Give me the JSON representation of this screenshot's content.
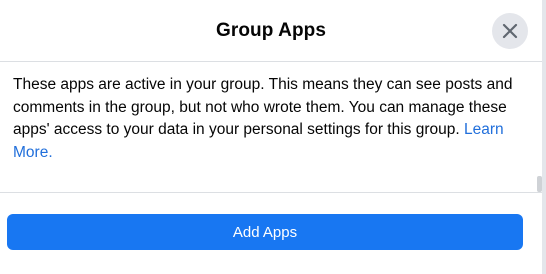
{
  "dialog": {
    "title": "Group Apps",
    "close_icon": "close-icon",
    "description": "These apps are active in your group. This means they can see posts and comments in the group, but not who wrote them. You can manage these apps' access to your data in your personal settings for this group.",
    "learn_more_label": "Learn More.",
    "add_button_label": "Add Apps"
  },
  "colors": {
    "primary": "#1877f2",
    "link": "#216fdb",
    "close_bg": "#e4e6eb",
    "text": "#050505"
  }
}
